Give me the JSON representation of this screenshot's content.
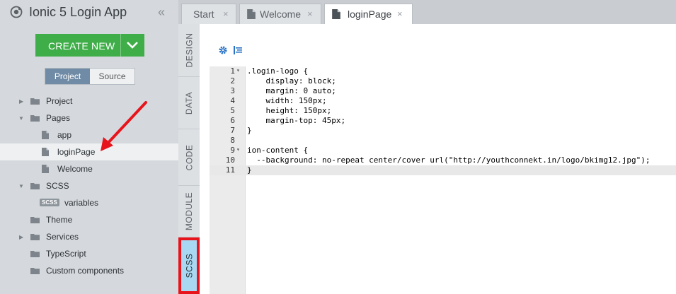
{
  "app": {
    "title": "Ionic 5 Login App",
    "collapse_glyph": "«"
  },
  "create_button": {
    "label": "CREATE NEW"
  },
  "segment": {
    "project": "Project",
    "source": "Source",
    "active": "Project"
  },
  "tree": [
    {
      "label": "Project",
      "type": "folder",
      "expanded": false
    },
    {
      "label": "Pages",
      "type": "folder",
      "expanded": true
    },
    {
      "label": "app",
      "type": "file"
    },
    {
      "label": "loginPage",
      "type": "file",
      "selected": true
    },
    {
      "label": "Welcome",
      "type": "file"
    },
    {
      "label": "SCSS",
      "type": "folder",
      "expanded": true
    },
    {
      "label": "variables",
      "type": "scss",
      "badge": "SCSS"
    },
    {
      "label": "Theme",
      "type": "folder"
    },
    {
      "label": "Services",
      "type": "folder",
      "expanded": false
    },
    {
      "label": "TypeScript",
      "type": "folder"
    },
    {
      "label": "Custom components",
      "type": "folder"
    }
  ],
  "tabs": [
    {
      "label": "Start",
      "close": "×",
      "active": false
    },
    {
      "label": "Welcome",
      "close": "×",
      "active": false,
      "icon": "file-icon"
    },
    {
      "label": "loginPage",
      "close": "×",
      "active": true,
      "icon": "file-icon"
    }
  ],
  "side_tabs": [
    {
      "label": "DESIGN",
      "active": false
    },
    {
      "label": "DATA",
      "active": false
    },
    {
      "label": "CODE",
      "active": false
    },
    {
      "label": "MODULE",
      "active": false
    },
    {
      "label": "SCSS",
      "active": true
    }
  ],
  "editor": {
    "lines": [
      {
        "n": "1",
        "fold": "▾",
        "text": ".login-logo {"
      },
      {
        "n": "2",
        "text": "    display: block;"
      },
      {
        "n": "3",
        "text": "    margin: 0 auto;"
      },
      {
        "n": "4",
        "text": "    width: 150px;"
      },
      {
        "n": "5",
        "text": "    height: 150px;"
      },
      {
        "n": "6",
        "text": "    margin-top: 45px;"
      },
      {
        "n": "7",
        "text": "}"
      },
      {
        "n": "8",
        "text": ""
      },
      {
        "n": "9",
        "fold": "▾",
        "text": "ion-content {"
      },
      {
        "n": "10",
        "text": "  --background: no-repeat center/cover url(\"http://youthconnekt.in/logo/bkimg12.jpg\");"
      },
      {
        "n": "11",
        "text": "}",
        "active": true
      }
    ]
  },
  "colors": {
    "accent_green": "#3fae49",
    "highlight_red": "#e8141c",
    "active_side_tab": "#a8d8f2"
  },
  "icons": [
    "app-logo-icon",
    "collapse-icon",
    "chevron-down-icon",
    "folder-icon",
    "file-icon",
    "caret-icon",
    "gear-icon",
    "format-icon",
    "close-icon"
  ]
}
